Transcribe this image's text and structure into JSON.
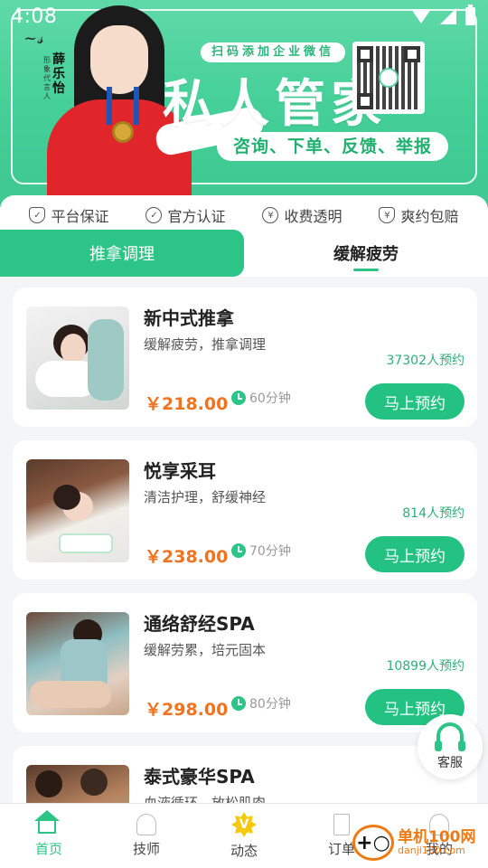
{
  "status": {
    "time": "4:08"
  },
  "banner": {
    "ambassador_name": "薛乐怡",
    "ambassador_role": "形象代言人",
    "wechat_tag": "扫码添加企业微信",
    "title": "私人管家",
    "services_pill": "咨询、下单、反馈、举报"
  },
  "guarantees": [
    {
      "label": "平台保证",
      "icon": "shield-check-icon"
    },
    {
      "label": "官方认证",
      "icon": "verified-badge-icon"
    },
    {
      "label": "收费透明",
      "icon": "yen-circle-icon"
    },
    {
      "label": "爽约包赔",
      "icon": "yen-shield-icon"
    }
  ],
  "tabs": [
    {
      "label": "推拿调理",
      "active": true
    },
    {
      "label": "缓解疲劳",
      "active": false
    }
  ],
  "services": [
    {
      "title": "新中式推拿",
      "desc": "缓解疲劳，推拿调理",
      "count": "37302人预约",
      "price": "￥218.00",
      "duration": "60分钟",
      "button": "马上预约"
    },
    {
      "title": "悦享采耳",
      "desc": "清洁护理，舒缓神经",
      "count": "814人预约",
      "price": "￥238.00",
      "duration": "70分钟",
      "button": "马上预约"
    },
    {
      "title": "通络舒经SPA",
      "desc": "缓解劳累，培元固本",
      "count": "10899人预约",
      "price": "￥298.00",
      "duration": "80分钟",
      "button": "马上预约"
    },
    {
      "title": "泰式豪华SPA",
      "desc": "血液循环，放松肌肉",
      "count": "",
      "price": "",
      "duration": "",
      "button": ""
    }
  ],
  "customer_service": {
    "label": "客服"
  },
  "nav": [
    {
      "label": "首页",
      "active": true
    },
    {
      "label": "技师",
      "active": false
    },
    {
      "label": "动态",
      "active": false
    },
    {
      "label": "订单",
      "active": false
    },
    {
      "label": "我的",
      "active": false
    }
  ],
  "watermark": {
    "main": "单机100网",
    "sub": "danji100.com"
  },
  "colors": {
    "brand_green": "#2dc487",
    "price_orange": "#f07320"
  }
}
